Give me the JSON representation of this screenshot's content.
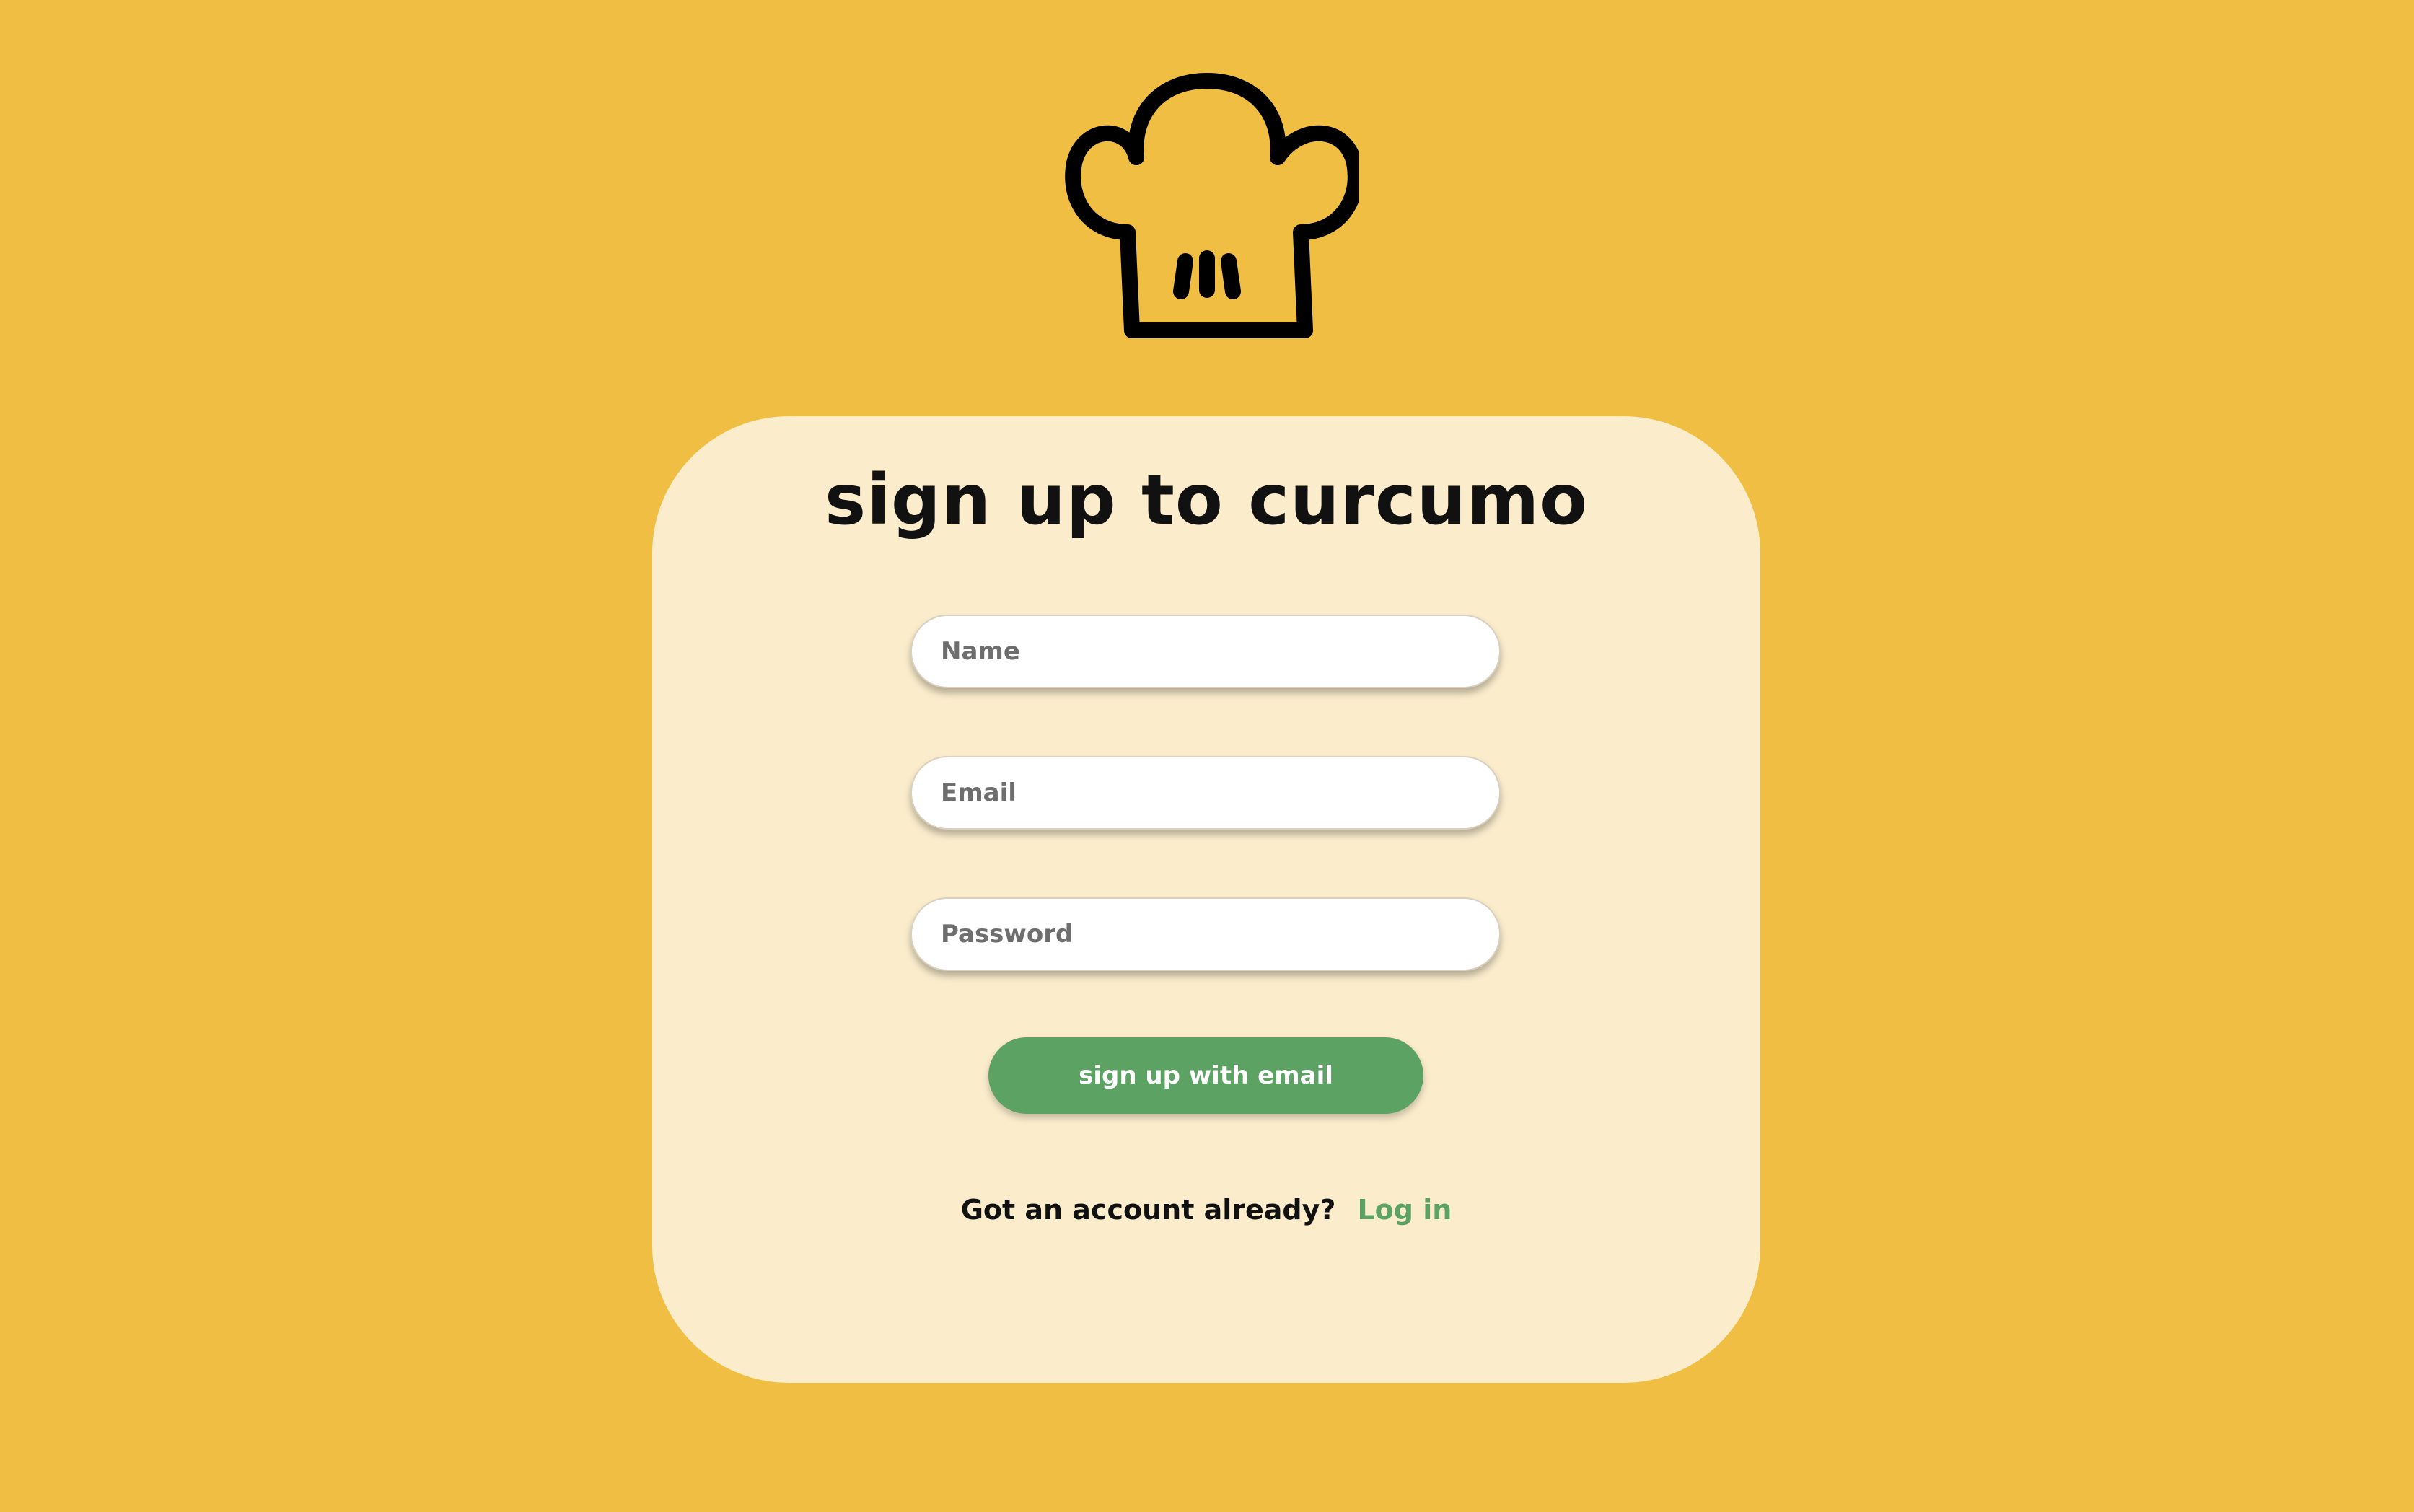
{
  "colors": {
    "background": "#F0BE42",
    "card": "#FBEDCC",
    "accent": "#5BA263",
    "text": "#111111"
  },
  "logo": {
    "icon": "chef-hat-icon"
  },
  "card": {
    "title": "sign up to curcumo",
    "fields": {
      "name_placeholder": "Name",
      "email_placeholder": "Email",
      "password_placeholder": "Password"
    },
    "submit_label": "sign up with email",
    "footer": {
      "prompt": "Got an account already?",
      "link_label": "Log in"
    }
  }
}
